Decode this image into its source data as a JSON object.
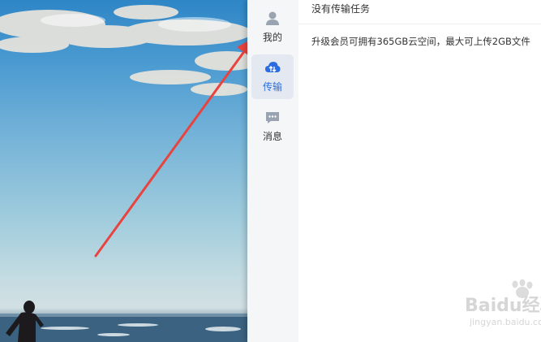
{
  "sidebar": {
    "items": [
      {
        "label": "我的",
        "icon": "user-icon"
      },
      {
        "label": "传输",
        "icon": "cloud-transfer-icon",
        "active": true
      },
      {
        "label": "消息",
        "icon": "chat-bubble-icon"
      }
    ]
  },
  "content": {
    "title": "没有传输任务",
    "promo_text": "升级会员可拥有365GB云空间，最大可上传2GB文件"
  },
  "watermark": {
    "brand": "Baidu经验",
    "url": "jingyan.baidu.com"
  },
  "colors": {
    "accent": "#2b6de0",
    "arrow": "#e8433f",
    "sidebar_bg": "#f5f6f8",
    "active_bg": "#e4e9f1"
  }
}
